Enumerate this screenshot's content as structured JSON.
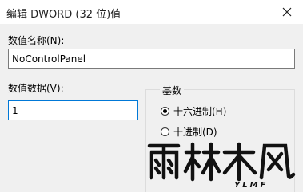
{
  "window": {
    "title": "编辑 DWORD (32 位)值",
    "close_icon": "close-icon"
  },
  "value_name": {
    "label": "数值名称(N):",
    "value": "NoControlPanel"
  },
  "value_data": {
    "label": "数值数据(V):",
    "value": "1"
  },
  "base": {
    "label": "基数",
    "options": [
      {
        "label": "十六进制(H)",
        "selected": true
      },
      {
        "label": "十进制(D)",
        "selected": false
      }
    ]
  },
  "watermark": {
    "text": "雨林木风",
    "subtext": "YLMF"
  }
}
